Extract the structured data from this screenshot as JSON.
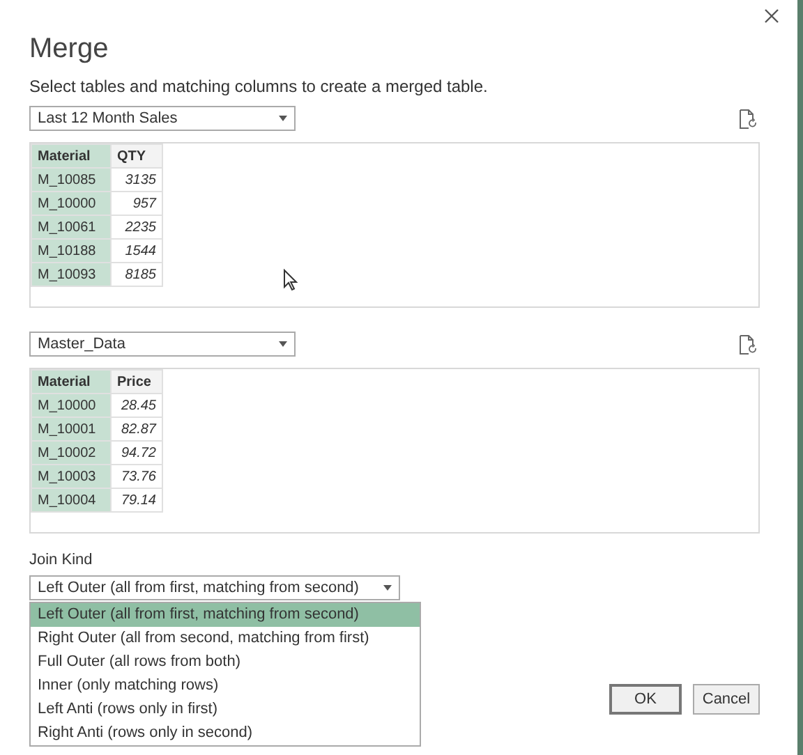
{
  "dialog": {
    "title": "Merge",
    "instruction": "Select tables and matching columns to create a merged table."
  },
  "tables": [
    {
      "source": "Last 12 Month Sales",
      "columns": [
        "Material",
        "QTY"
      ],
      "rows": [
        [
          "M_10085",
          "3135"
        ],
        [
          "M_10000",
          "957"
        ],
        [
          "M_10061",
          "2235"
        ],
        [
          "M_10188",
          "1544"
        ],
        [
          "M_10093",
          "8185"
        ]
      ]
    },
    {
      "source": "Master_Data",
      "columns": [
        "Material",
        "Price"
      ],
      "rows": [
        [
          "M_10000",
          "28.45"
        ],
        [
          "M_10001",
          "82.87"
        ],
        [
          "M_10002",
          "94.72"
        ],
        [
          "M_10003",
          "73.76"
        ],
        [
          "M_10004",
          "79.14"
        ]
      ]
    }
  ],
  "join_kind": {
    "label": "Join Kind",
    "value": "Left Outer (all from first, matching from second)",
    "expanded": true,
    "options": [
      {
        "label": "Left Outer (all from first, matching from second)",
        "selected": true
      },
      {
        "label": "Right Outer (all from second, matching from first)",
        "selected": false
      },
      {
        "label": "Full Outer (all rows from both)",
        "selected": false
      },
      {
        "label": "Inner (only matching rows)",
        "selected": false
      },
      {
        "label": "Left Anti (rows only in first)",
        "selected": false
      },
      {
        "label": "Right Anti (rows only in second)",
        "selected": false
      }
    ]
  },
  "buttons": [
    "OK",
    "Cancel"
  ]
}
